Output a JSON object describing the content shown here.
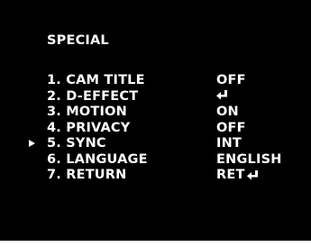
{
  "menu": {
    "title": "SPECIAL",
    "items": [
      {
        "label": "1. CAM TITLE",
        "value": "OFF",
        "icon": null,
        "selected": false
      },
      {
        "label": "2. D-EFFECT",
        "value": "",
        "icon": "enter-icon",
        "selected": false
      },
      {
        "label": "3. MOTION",
        "value": "ON",
        "icon": null,
        "selected": false
      },
      {
        "label": "4. PRIVACY",
        "value": "OFF",
        "icon": null,
        "selected": false
      },
      {
        "label": "5. SYNC",
        "value": "INT",
        "icon": null,
        "selected": true
      },
      {
        "label": "6. LANGUAGE",
        "value": "ENGLISH",
        "icon": null,
        "selected": false
      },
      {
        "label": "7. RETURN",
        "value": "RET",
        "icon": "enter-icon",
        "selected": false
      }
    ]
  },
  "colors": {
    "background": "#000000",
    "text": "#ffffff"
  }
}
